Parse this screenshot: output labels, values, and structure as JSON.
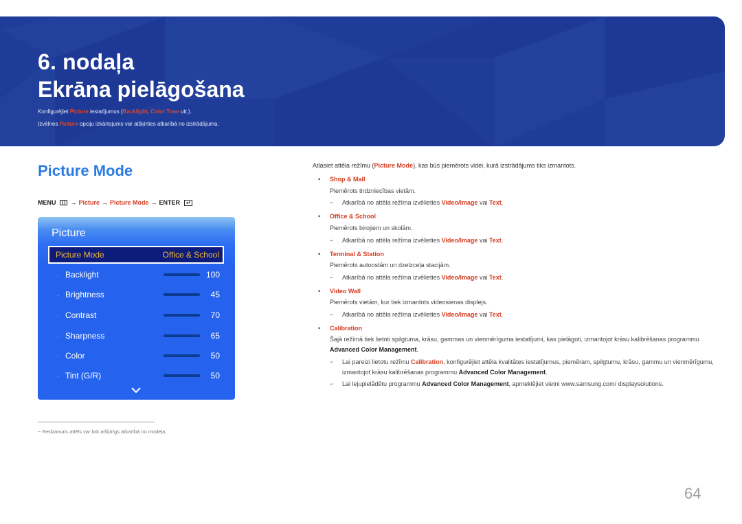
{
  "header": {
    "chapter": "6. nodaļa",
    "title": "Ekrāna pielāgošana",
    "line1": {
      "prefix": "Konfigurējiet ",
      "picture": "Picture",
      "mid": " iestatījumus (",
      "backlight": "Backlight",
      "comma": ", ",
      "color_tone": "Color Tone",
      "suffix": " utt.)."
    },
    "line2": {
      "prefix": "Izvēlnes ",
      "picture": "Picture",
      "suffix": " opciju izkārtojums var atšķirties atkarībā no izstrādājuma."
    }
  },
  "section": {
    "title": "Picture Mode",
    "menu_path": {
      "menu": "MENU",
      "arrow": "→",
      "picture": "Picture",
      "picture_mode": "Picture Mode",
      "enter": "ENTER"
    }
  },
  "osd": {
    "title": "Picture",
    "selected": {
      "label": "Picture Mode",
      "value": "Office & School"
    },
    "rows": [
      {
        "label": "Backlight",
        "value": 100,
        "max": 100
      },
      {
        "label": "Brightness",
        "value": 45,
        "max": 100
      },
      {
        "label": "Contrast",
        "value": 70,
        "max": 100
      },
      {
        "label": "Sharpness",
        "value": 65,
        "max": 100
      },
      {
        "label": "Color",
        "value": 50,
        "max": 100
      },
      {
        "label": "Tint (G/R)",
        "value": 50,
        "max": 100
      }
    ],
    "bullet": "·",
    "chevron_icon": "chevron-down-icon"
  },
  "footnote": {
    "dash": "−",
    "text": "Redzamais attēls var būt atšķirīgs atkarībā no modeļa."
  },
  "right": {
    "intro": {
      "prefix": "Atlasiet attēla režīmu (",
      "picture_mode": "Picture Mode",
      "suffix": "), kas būs piemērots videi, kurā izstrādājums tiks izmantots."
    },
    "bullet": "•",
    "dash": "−",
    "note_common": {
      "prefix": "Atkarībā no attēla režīma izvēlieties ",
      "video_image": "Video/Image",
      "mid": " vai ",
      "text": "Text",
      "suffix": "."
    },
    "items": [
      {
        "name": "Shop & Mall",
        "desc": "Piemērots tirdzniecības vietām."
      },
      {
        "name": "Office & School",
        "desc": "Piemērots birojiem un skolām."
      },
      {
        "name": "Terminal & Station",
        "desc": "Piemērots autoostām un dzelzceļa stacijām."
      },
      {
        "name": "Video Wall",
        "desc": "Piemērots vietām, kur tiek izmantots videosienas displejs."
      },
      {
        "name": "Calibration"
      }
    ],
    "calibration": {
      "para_prefix": "Šajā režīmā tiek lietoti spilgtuma, krāsu, gammas un vienmērīguma iestatījumi, kas pielāgoti, izmantojot krāsu kalibrēšanas programmu ",
      "acm": "Advanced Color Management",
      "para_suffix": ".",
      "note1_prefix": "Lai pareizi lietotu režīmu ",
      "note1_cal": "Calibration",
      "note1_mid": ", konfigurējiet attēla kvalitātes iestatījumus, piemēram, spilgtumu, krāsu, gammu un vienmērīgumu, izmantojot krāsu kalibrēšanas programmu ",
      "note1_suffix": ".",
      "note2_prefix": "Lai lejupielādētu programmu ",
      "note2_suffix": ", apmeklējiet vietni www.samsung.com/ displaysolutions."
    }
  },
  "page_number": "64",
  "colors": {
    "banner": "#1f3c98",
    "accent_red": "#d53c22",
    "title_blue": "#2b7be3",
    "osd_blue": "#2563ee",
    "osd_selected_bg": "#0d1b7a",
    "osd_selected_text": "#f0b83a",
    "bar_fill": "#7fe6da",
    "bar_track": "#0c3b92"
  }
}
